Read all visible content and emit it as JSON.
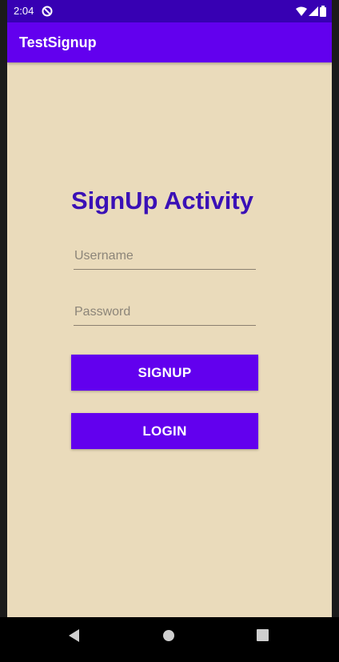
{
  "status_bar": {
    "time": "2:04",
    "icons": [
      "sync-icon",
      "wifi-icon",
      "cell-signal-icon",
      "battery-icon"
    ]
  },
  "app_bar": {
    "title": "TestSignup"
  },
  "form": {
    "heading": "SignUp Activity",
    "username": {
      "placeholder": "Username",
      "value": ""
    },
    "password": {
      "placeholder": "Password",
      "value": ""
    },
    "signup_label": "SIGNUP",
    "login_label": "LOGIN"
  },
  "nav_bar": {
    "icons": [
      "back-icon",
      "home-icon",
      "recents-icon"
    ]
  },
  "colors": {
    "status_bar": "#3700b3",
    "primary": "#6200ee",
    "background": "#eadbbb",
    "heading": "#3a10b6"
  }
}
